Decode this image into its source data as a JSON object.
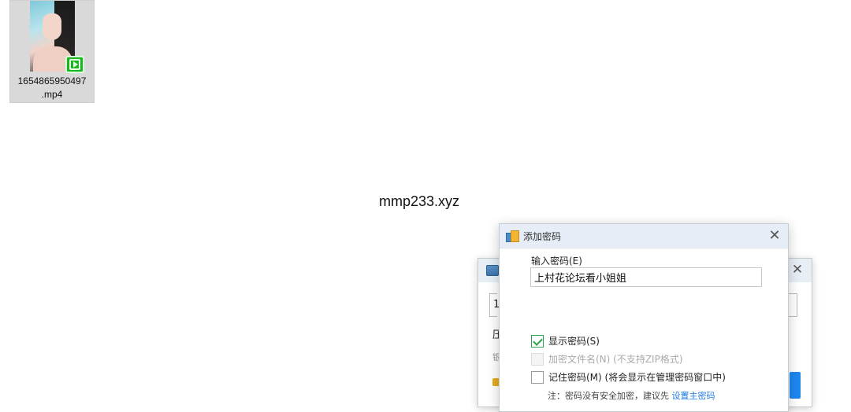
{
  "desktop": {
    "file": {
      "name_line1": "1654865950497",
      "name_line2": ".mp4",
      "badge_icon": "video-play-icon"
    }
  },
  "watermark": {
    "text": "mmp233.xyz"
  },
  "background_dialog": {
    "field_fragment": "1",
    "label_fragment": "压",
    "sub_label_fragment": "银",
    "close_glyph": "✕"
  },
  "dialog": {
    "title": "添加密码",
    "close_glyph": "✕",
    "password_label": "输入密码(E)",
    "password_value": "上村花论坛看小姐姐",
    "options": {
      "show_password": "显示密码(S)",
      "encrypt_filenames": "加密文件名(N) (不支持ZIP格式)",
      "remember_password": "记住密码(M) (将会显示在管理密码窗口中)"
    },
    "note_prefix": "注：密码没有安全加密，建议先 ",
    "note_link": "设置主密码"
  },
  "colors": {
    "titlebar": "#e6edf6",
    "check_green": "#2aa34a",
    "link_blue": "#1f7ae0",
    "primary_button": "#1d86f0"
  }
}
